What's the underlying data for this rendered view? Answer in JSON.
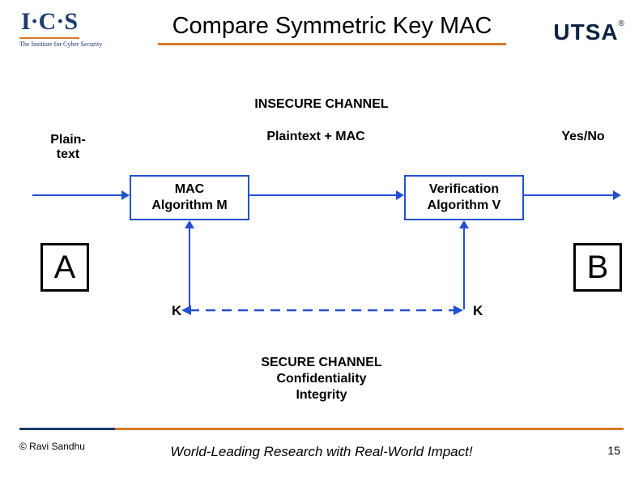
{
  "header": {
    "title": "Compare Symmetric Key MAC",
    "logo_left_top": "I·C·S",
    "logo_left_sub": "The Institute for Cyber Security",
    "logo_right": "UTSA"
  },
  "labels": {
    "insecure_channel": "INSECURE CHANNEL",
    "plaintext": "Plain-\ntext",
    "plaintext_mac": "Plaintext + MAC",
    "yes_no": "Yes/No",
    "mac_algorithm": "MAC\nAlgorithm M",
    "verification_algorithm": "Verification\nAlgorithm V",
    "party_a": "A",
    "party_b": "B",
    "key_left": "K",
    "key_right": "K",
    "secure_channel": "SECURE CHANNEL\nConfidentiality\nIntegrity"
  },
  "footer": {
    "copyright": "© Ravi  Sandhu",
    "tagline": "World-Leading Research with Real-World Impact!",
    "page": "15"
  },
  "colors": {
    "accent_orange": "#d97828",
    "accent_blue": "#2151d1",
    "brand_navy": "#1c3a6e"
  }
}
